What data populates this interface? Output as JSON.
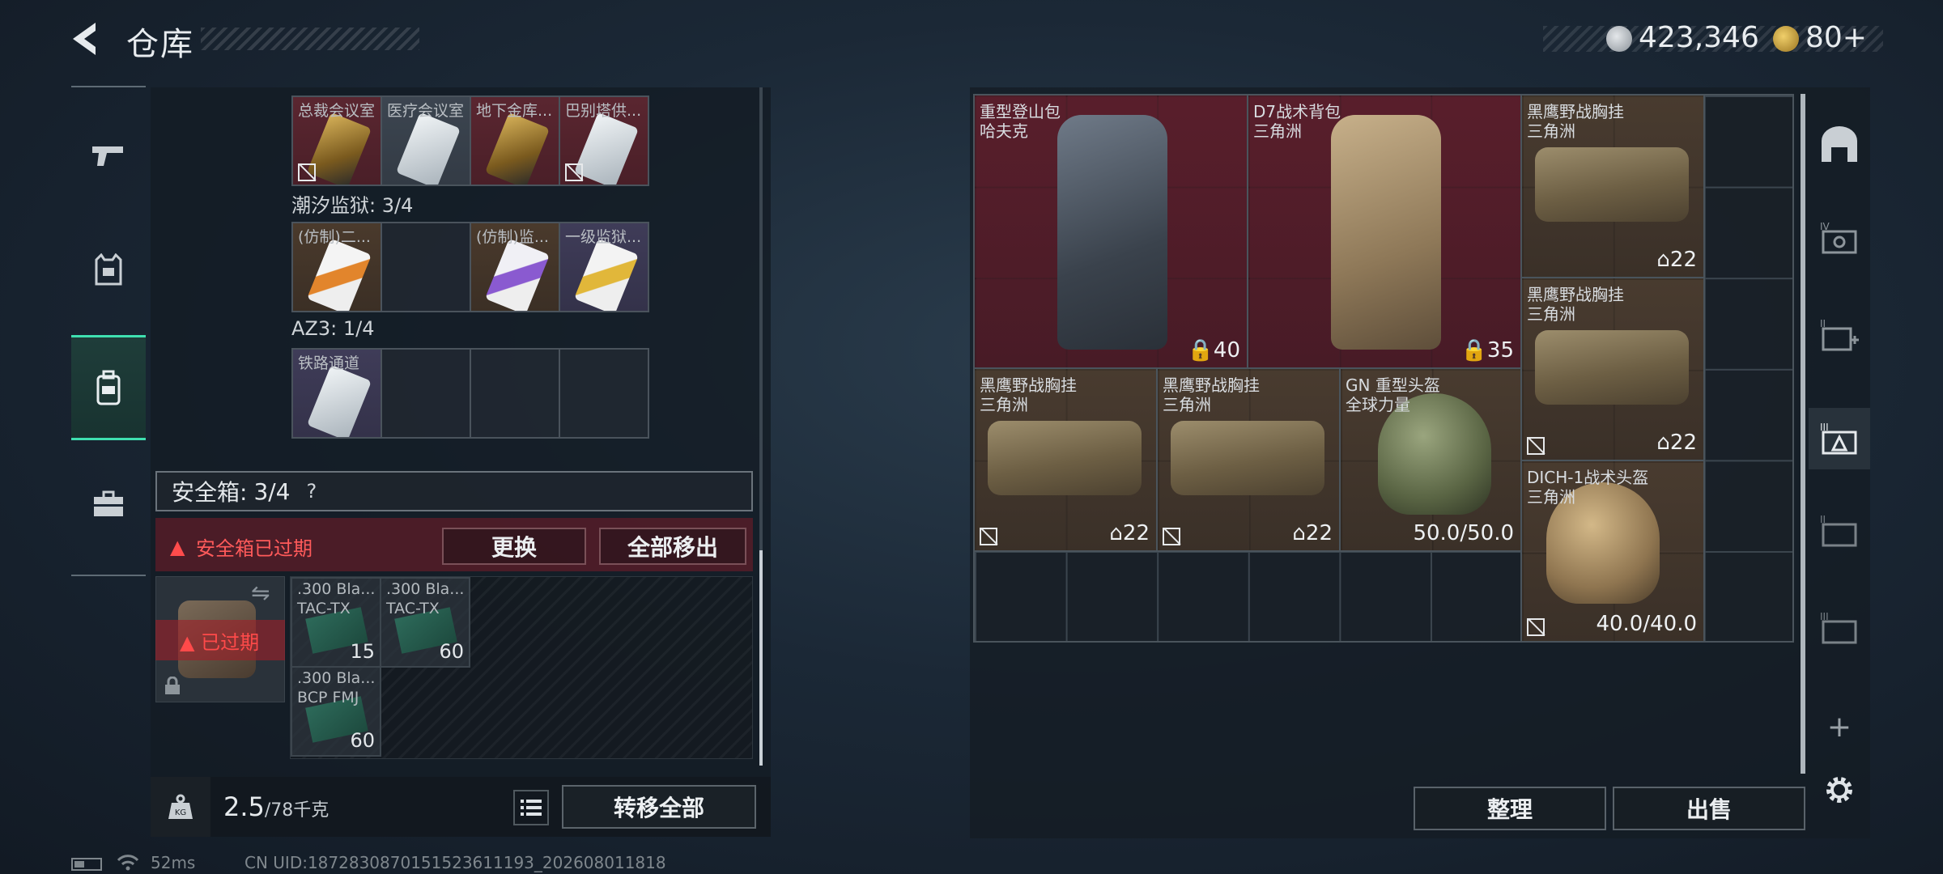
{
  "header": {
    "title": "仓库",
    "currency_silver": "423,346",
    "currency_gold": "80+"
  },
  "left_sidebar": {
    "items": [
      {
        "icon": "gun-icon"
      },
      {
        "icon": "armor-vest-icon"
      },
      {
        "icon": "backpack-icon",
        "active": true
      },
      {
        "icon": "toolbox-icon"
      }
    ]
  },
  "keycards": {
    "row1": [
      "总裁会议室",
      "医疗会议室",
      "地下金库...",
      "巴别塔供..."
    ],
    "section2_label": "潮汐监狱: 3/4",
    "row2": [
      "(仿制)二...",
      "",
      "(仿制)监...",
      "一级监狱..."
    ],
    "section3_label": "AZ3: 1/4",
    "row3": [
      "铁路通道",
      "",
      "",
      ""
    ]
  },
  "safe_box": {
    "label": "安全箱:",
    "count": "3/4",
    "help": "?",
    "expired_warning": "安全箱已过期",
    "swap_button": "更换",
    "move_all_button": "全部移出",
    "case_status": "已过期"
  },
  "ammo": [
    {
      "line1": ".300 Bla...",
      "line2": "TAC-TX",
      "count": "15"
    },
    {
      "line1": ".300 Bla...",
      "line2": "TAC-TX",
      "count": "60"
    },
    {
      "line1": ".300 Bla...",
      "line2": "BCP FMJ",
      "count": "60"
    }
  ],
  "weight": {
    "current": "2.5",
    "max": "/78千克",
    "kg_icon": "KG",
    "transfer_all_button": "转移全部"
  },
  "status_bar": {
    "ping": "52ms",
    "uid": "CN UID:1872830870151523611193_202608011818"
  },
  "stash_items": [
    {
      "name": "重型登山包",
      "brand": "哈夫克",
      "value": "40"
    },
    {
      "name": "D7战术背包",
      "brand": "三角洲",
      "value": "35"
    },
    {
      "name": "黑鹰野战胸挂",
      "brand": "三角洲",
      "value": "22"
    },
    {
      "name": "黑鹰野战胸挂",
      "brand": "三角洲",
      "value": "22"
    },
    {
      "name": "黑鹰野战胸挂",
      "brand": "三角洲",
      "value": "22"
    },
    {
      "name": "黑鹰野战胸挂",
      "brand": "三角洲",
      "value": "22"
    },
    {
      "name": "GN 重型头盔",
      "brand": "全球力量",
      "value": "50.0/50.0"
    },
    {
      "name": "DICH-1战术头盔",
      "brand": "三角洲",
      "value": "40.0/40.0"
    }
  ],
  "right_actions": {
    "sort_button": "整理",
    "sell_button": "出售",
    "add_symbol": "+"
  }
}
